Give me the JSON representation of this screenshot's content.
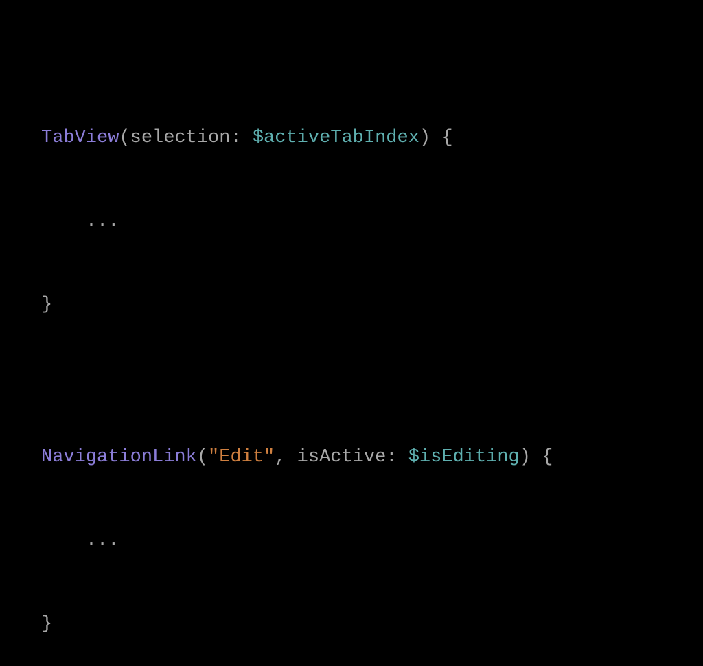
{
  "code": {
    "block1": {
      "line1": {
        "type": "TabView",
        "open_paren": "(",
        "param_label": "selection: ",
        "param_value": "$activeTabIndex",
        "close_paren": ")",
        "space": " ",
        "brace_open": "{"
      },
      "line2": {
        "indent": "    ",
        "ellipsis": "..."
      },
      "line3": {
        "brace_close": "}"
      }
    },
    "block2": {
      "line1": {
        "type": "NavigationLink",
        "open_paren": "(",
        "string": "\"Edit\"",
        "comma": ", ",
        "param_label": "isActive: ",
        "param_value": "$isEditing",
        "close_paren": ")",
        "space": " ",
        "brace_open": "{"
      },
      "line2": {
        "indent": "    ",
        "ellipsis": "..."
      },
      "line3": {
        "brace_close": "}"
      }
    }
  }
}
